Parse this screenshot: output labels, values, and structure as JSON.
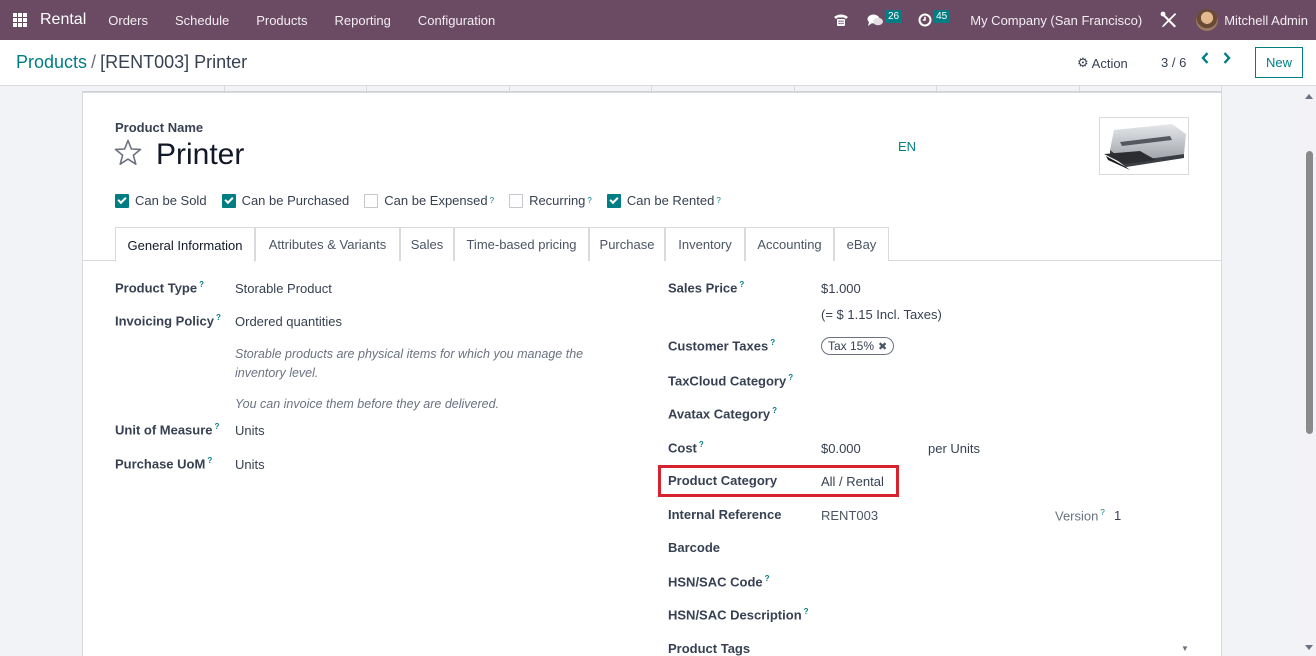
{
  "navbar": {
    "app_name": "Rental",
    "menu": [
      "Orders",
      "Schedule",
      "Products",
      "Reporting",
      "Configuration"
    ],
    "icons": {
      "apps": "apps-grid-icon",
      "phone": "phone-icon",
      "messages": "chat-icon",
      "activities": "clock-icon",
      "debug": "tools-icon"
    },
    "messages_count": "26",
    "activities_count": "45",
    "company": "My Company (San Francisco)",
    "user": "Mitchell Admin",
    "color": "#6b4a63"
  },
  "control_panel": {
    "breadcrumb_parent": "Products",
    "breadcrumb_separator": "/",
    "breadcrumb_current": "[RENT003] Printer",
    "action_label": "Action",
    "pager": "3 / 6",
    "new_label": "New",
    "accent_color": "#017e84"
  },
  "form": {
    "product_name_label": "Product Name",
    "product_name": "Printer",
    "language": "EN",
    "checkboxes": [
      {
        "label": "Can be Sold",
        "checked": true,
        "help": false
      },
      {
        "label": "Can be Purchased",
        "checked": true,
        "help": false
      },
      {
        "label": "Can be Expensed",
        "checked": false,
        "help": true
      },
      {
        "label": "Recurring",
        "checked": false,
        "help": true
      },
      {
        "label": "Can be Rented",
        "checked": true,
        "help": true
      }
    ],
    "tabs": [
      "General Information",
      "Attributes & Variants",
      "Sales",
      "Time-based pricing",
      "Purchase",
      "Inventory",
      "Accounting",
      "eBay"
    ],
    "active_tab": "General Information",
    "help_marker": "?",
    "left_fields": {
      "product_type": {
        "label": "Product Type",
        "value": "Storable Product"
      },
      "invoicing_policy": {
        "label": "Invoicing Policy",
        "value": "Ordered quantities"
      },
      "help_text_1": "Storable products are physical items for which you manage the inventory level.",
      "help_text_2": "You can invoice them before they are delivered.",
      "unit_of_measure": {
        "label": "Unit of Measure",
        "value": "Units"
      },
      "purchase_uom": {
        "label": "Purchase UoM",
        "value": "Units"
      }
    },
    "right_fields": {
      "sales_price": {
        "label": "Sales Price",
        "value": "$1.000",
        "incl_taxes": "(= $ 1.15 Incl. Taxes)"
      },
      "customer_taxes": {
        "label": "Customer Taxes",
        "tag": "Tax 15%"
      },
      "taxcloud_category": {
        "label": "TaxCloud Category",
        "value": ""
      },
      "avatax_category": {
        "label": "Avatax Category",
        "value": ""
      },
      "cost": {
        "label": "Cost",
        "value": "$0.000",
        "per": "per Units"
      },
      "product_category": {
        "label": "Product Category",
        "value": "All / Rental"
      },
      "internal_reference": {
        "label": "Internal Reference",
        "value": "RENT003"
      },
      "version": {
        "label": "Version",
        "value": "1"
      },
      "barcode": {
        "label": "Barcode",
        "value": ""
      },
      "hsn_sac_code": {
        "label": "HSN/SAC Code",
        "value": ""
      },
      "hsn_sac_description": {
        "label": "HSN/SAC Description",
        "value": ""
      },
      "product_tags": {
        "label": "Product Tags",
        "value": ""
      }
    },
    "highlight_color": "#d6232f"
  }
}
